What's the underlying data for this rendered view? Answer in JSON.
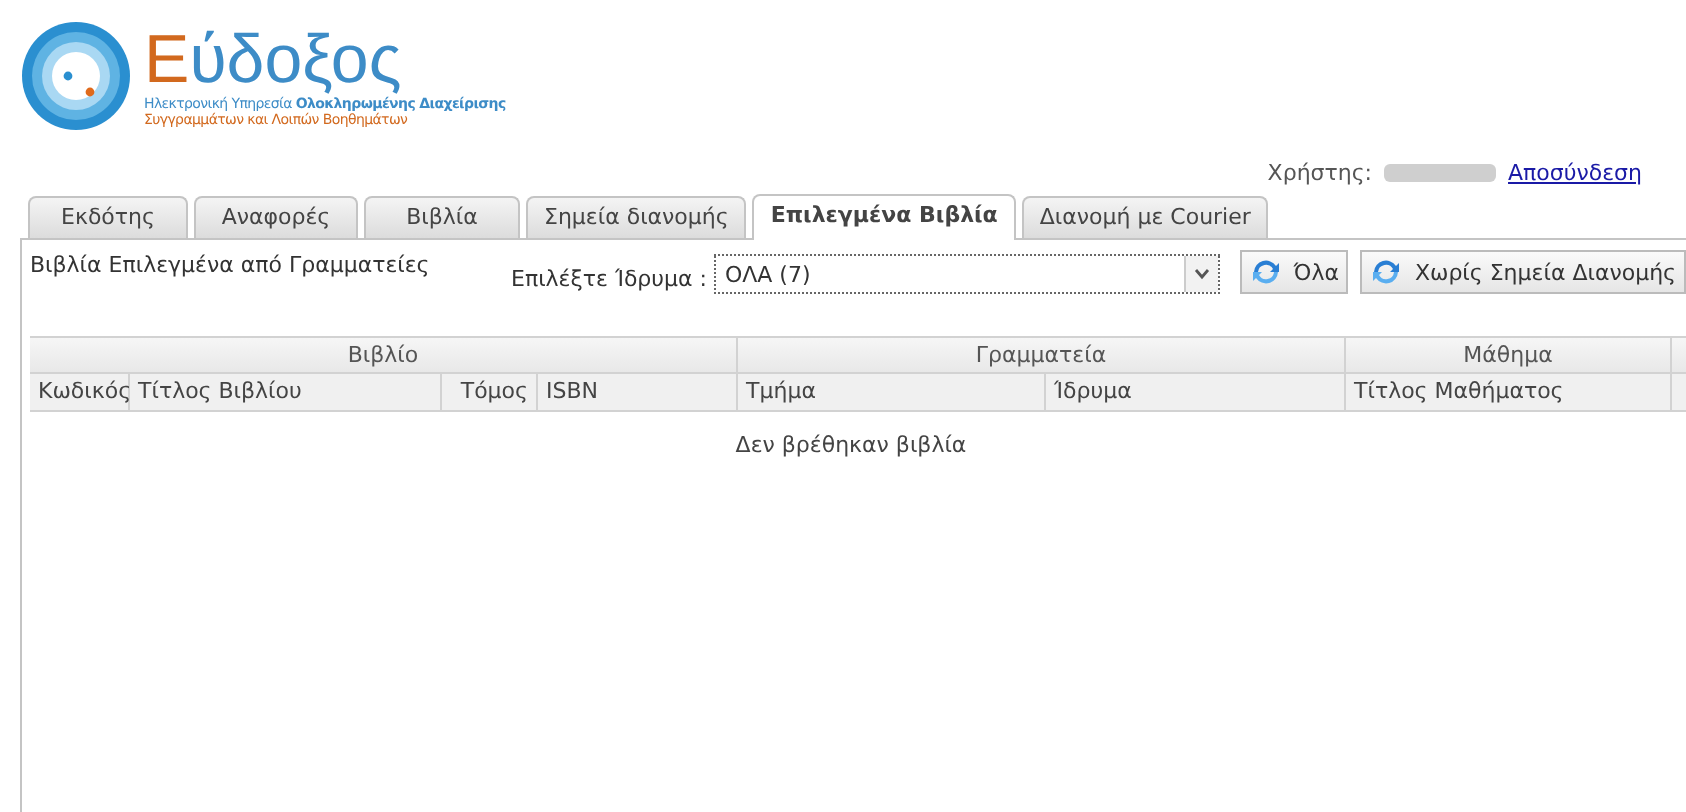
{
  "logo": {
    "title": "Εύδοξος",
    "subtitle_1": "Ηλεκτρονική Υπηρεσία **Ολοκληρωμένης Διαχείρισης**",
    "subtitle_2": "Συγγραμμάτων και Λοιπών Βοηθημάτων"
  },
  "user": {
    "label": "Χρήστης:",
    "logout": "Αποσύνδεση"
  },
  "tabs": [
    {
      "label": "Εκδότης",
      "selected": false
    },
    {
      "label": "Αναφορές",
      "selected": false
    },
    {
      "label": "Βιβλία",
      "selected": false
    },
    {
      "label": "Σημεία διανομής",
      "selected": false
    },
    {
      "label": "Επιλεγμένα Βιβλία",
      "selected": true
    },
    {
      "label": "Διανομή με Courier",
      "selected": false
    }
  ],
  "panel": {
    "title": "Βιβλία Επιλεγμένα από Γραμματείες",
    "filter_label": "Επιλέξτε Ίδρυμα :",
    "filter_value": "ΟΛΑ (7)",
    "buttons": [
      "Όλα",
      "Χωρίς Σημεία Διανομής"
    ]
  },
  "table": {
    "groups": [
      "Βιβλίο",
      "Γραμματεία",
      "Μάθημα"
    ],
    "columns": [
      "Κωδικός",
      "Τίτλος Βιβλίου",
      "Τόμος",
      "ISBN",
      "Τμήμα",
      "Ίδρυμα",
      "Τίτλος Μαθήματος"
    ],
    "empty_message": "Δεν βρέθηκαν βιβλία"
  }
}
